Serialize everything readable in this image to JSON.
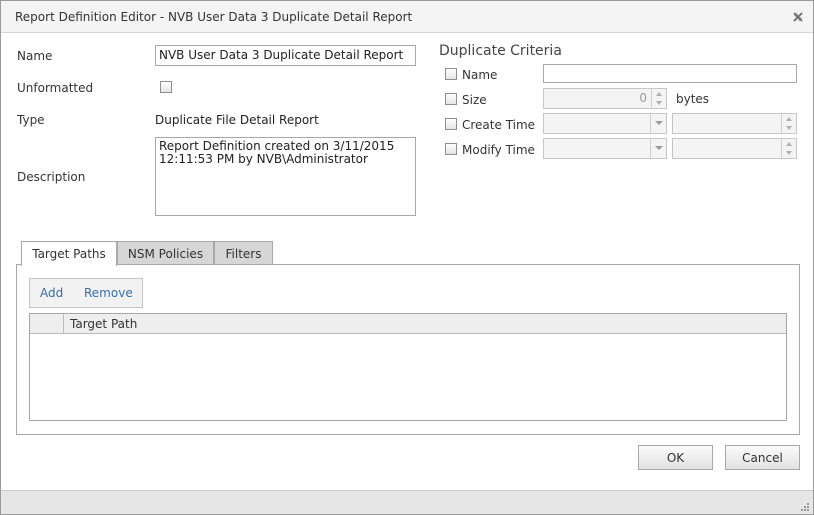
{
  "window": {
    "title": "Report Definition Editor - NVB User Data 3 Duplicate Detail Report"
  },
  "form": {
    "name_label": "Name",
    "name_value": "NVB User Data 3 Duplicate Detail Report",
    "unformatted_label": "Unformatted",
    "unformatted_checked": false,
    "type_label": "Type",
    "type_value": "Duplicate File Detail Report",
    "description_label": "Description",
    "description_value": "Report Definition created on 3/11/2015 12:11:53 PM by NVB\\Administrator"
  },
  "criteria": {
    "title": "Duplicate Criteria",
    "name_label": "Name",
    "name_value": "",
    "size_label": "Size",
    "size_value": "0",
    "size_unit": "bytes",
    "create_time_label": "Create Time",
    "modify_time_label": "Modify Time"
  },
  "tabs": [
    {
      "label": "Target Paths",
      "active": true
    },
    {
      "label": "NSM Policies",
      "active": false
    },
    {
      "label": "Filters",
      "active": false
    }
  ],
  "toolbar": {
    "add_label": "Add",
    "remove_label": "Remove"
  },
  "grid": {
    "columns": [
      "Target Path"
    ],
    "rows": []
  },
  "buttons": {
    "ok_label": "OK",
    "cancel_label": "Cancel"
  },
  "icons": {
    "close": "close-icon",
    "resize_grip": "resize-grip-icon"
  }
}
